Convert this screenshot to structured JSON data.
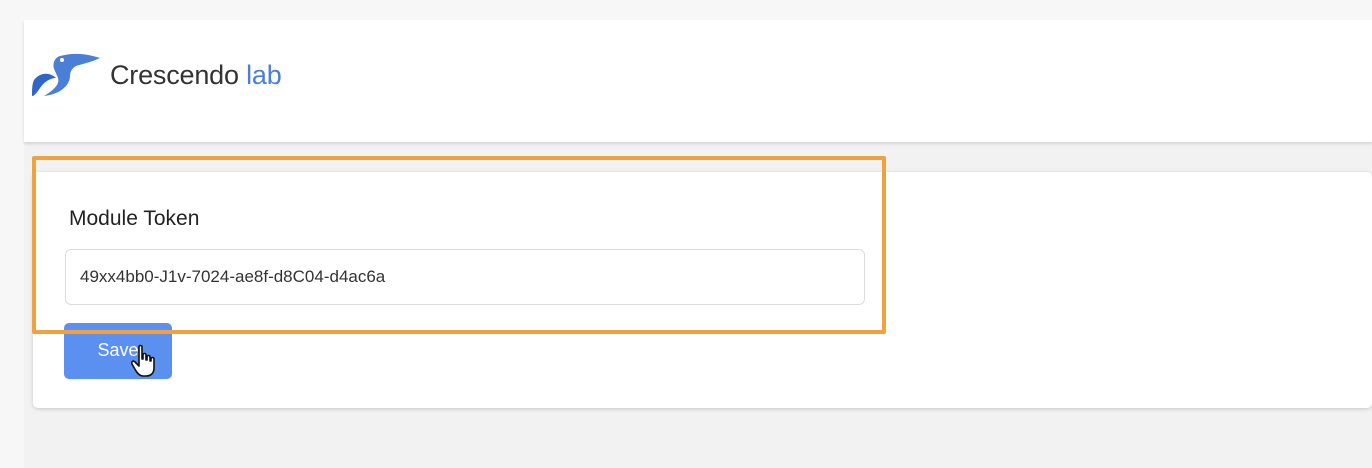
{
  "header": {
    "brand_primary": "Crescendo",
    "brand_accent": "lab",
    "logo_icon": "crescendo-bird-logo",
    "accent_color": "#4a7fd8"
  },
  "form": {
    "token_label": "Module Token",
    "token_value": "49xx4bb0-J1v-7024-ae8f-d8C04-d4ac6a",
    "save_label": "Save",
    "button_color": "#5b8ff0"
  },
  "annotation": {
    "highlight_color": "#f0a140"
  }
}
